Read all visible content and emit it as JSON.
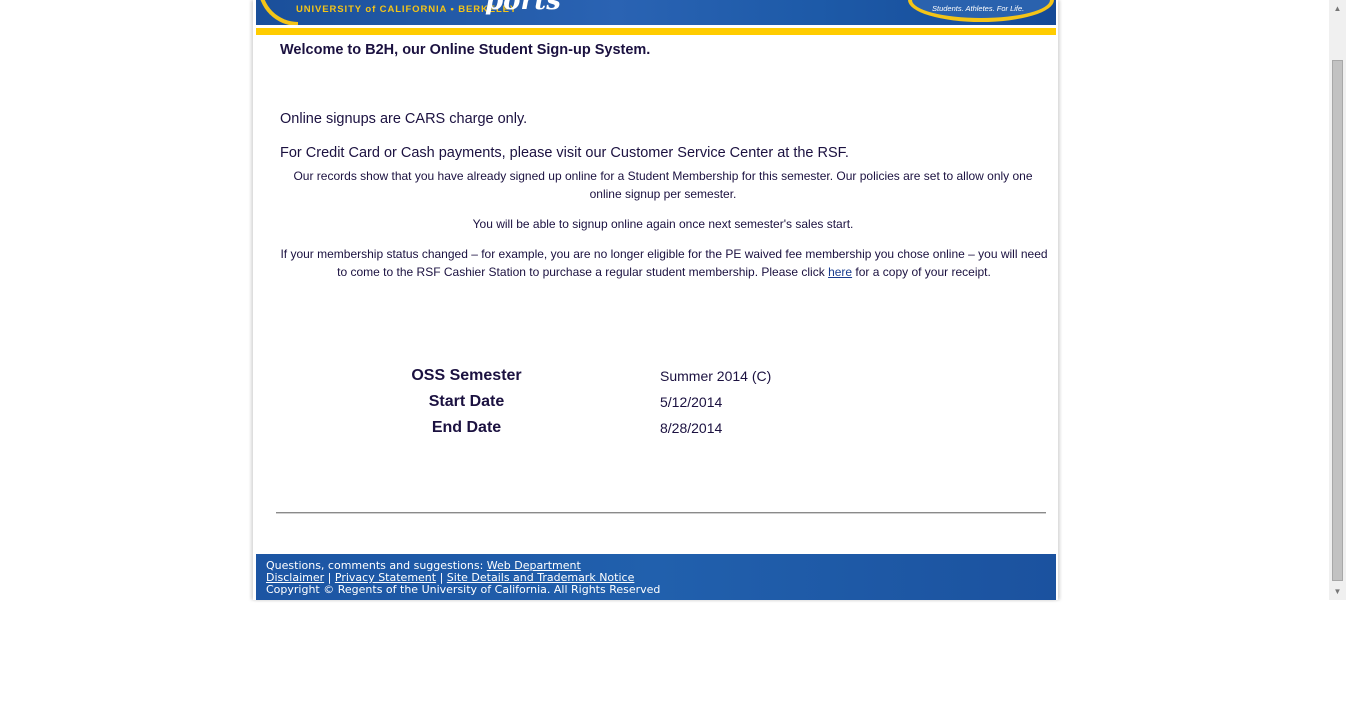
{
  "header": {
    "university": "UNIVERSITY of CALIFORNIA • BERKELEY",
    "site_script": "ports",
    "tagline": "Students. Athletes. For Life."
  },
  "main": {
    "welcome": "Welcome to B2H, our Online Student Sign-up System.",
    "cars_notice": "Online signups are CARS charge only.",
    "payment_notice": "For Credit Card or Cash payments, please visit our Customer Service Center at the RSF.",
    "records_notice": "Our records show that you have already signed up online for a Student Membership for this semester. Our policies are set to allow only one online signup per semester.",
    "next_semester_notice": "You will be able to signup online again once next semester's sales start.",
    "status_notice_before": "If your membership status changed – for example, you are no longer eligible for the PE waived fee membership you chose online – you will need to come to the RSF Cashier Station to purchase a regular student membership. Please click ",
    "receipt_link": "here",
    "status_notice_after": " for a copy of your receipt."
  },
  "semester": {
    "oss_label": "OSS Semester",
    "oss_value": "Summer 2014 (C)",
    "start_label": "Start Date",
    "start_value": "5/12/2014",
    "end_label": "End Date",
    "end_value": "8/28/2014"
  },
  "footer": {
    "questions_text": "Questions, comments and suggestions: ",
    "web_dept_link": "Web Department",
    "disclaimer_link": "Disclaimer",
    "privacy_link": "Privacy Statement",
    "trademark_link": "Site Details and Trademark Notice",
    "separator": " | ",
    "copyright": "Copyright © Regents of the University of California. All Rights Reserved"
  },
  "colors": {
    "banner_blue": "#1d5aa8",
    "gold": "#ffcc00",
    "text_navy": "#1b1140"
  }
}
